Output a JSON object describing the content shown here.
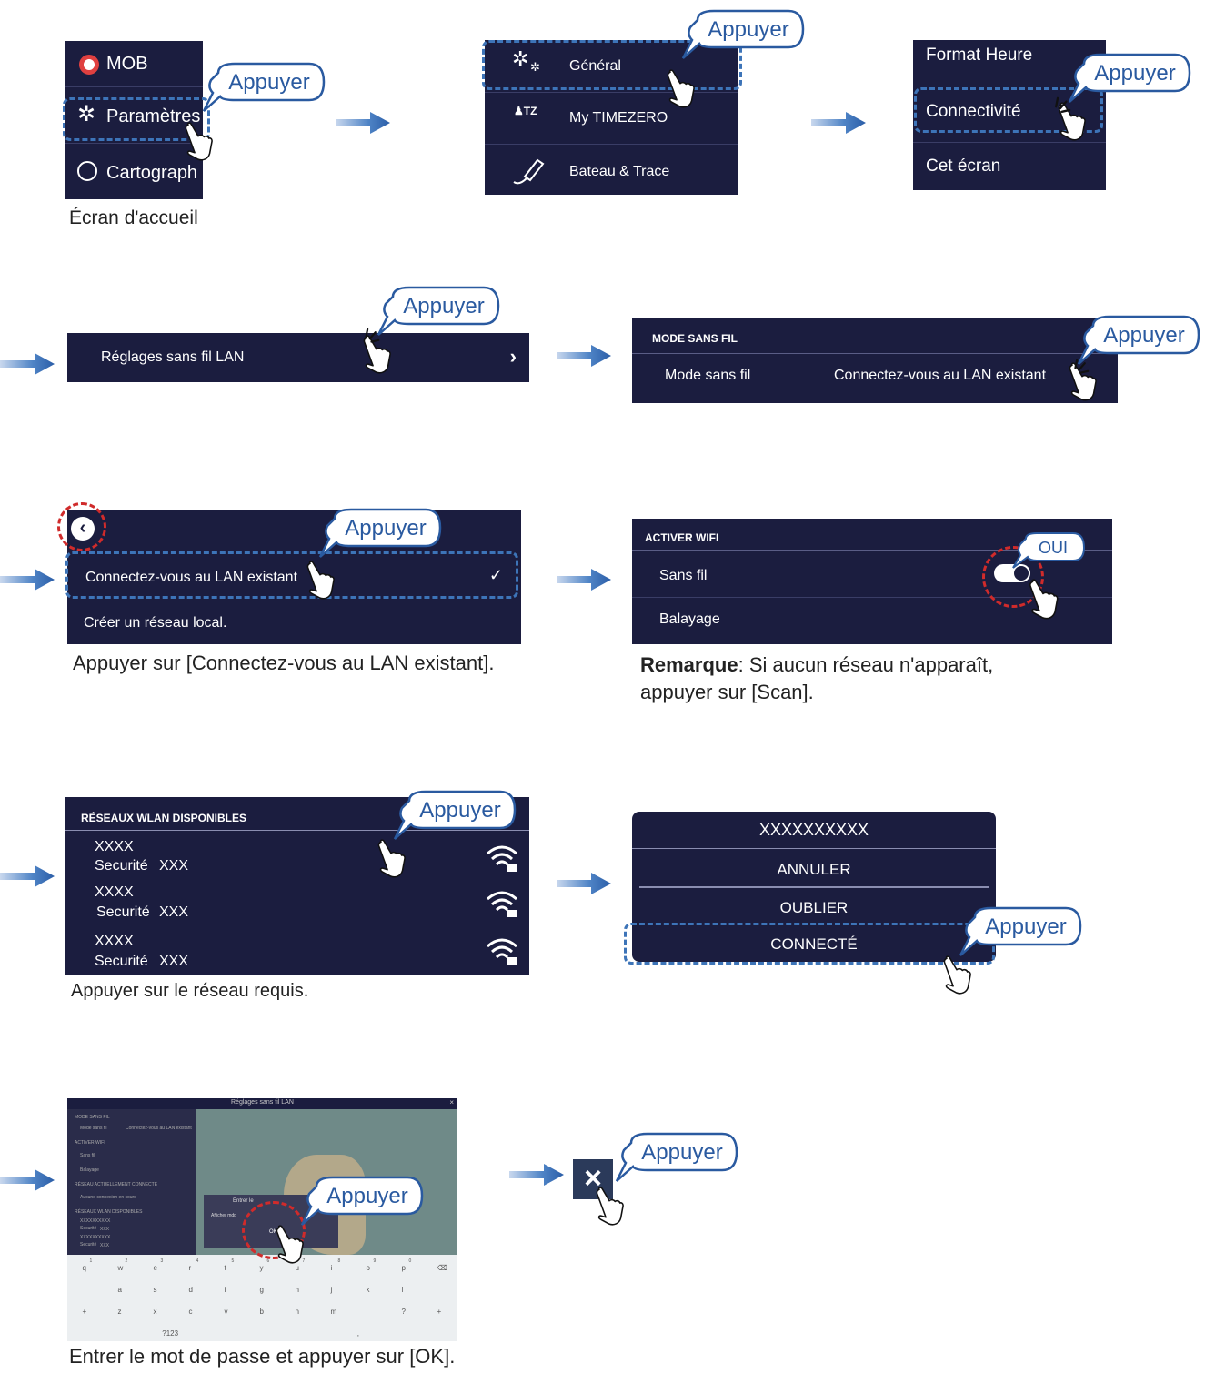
{
  "bubble_label": "Appuyer",
  "step1": {
    "items": [
      "MOB",
      "Paramètres",
      "Cartograph"
    ],
    "caption": "Écran d'accueil"
  },
  "step2": {
    "items": [
      "Général",
      "My TIMEZERO",
      "Bateau & Trace"
    ]
  },
  "step3": {
    "items": [
      "Format Heure",
      "Connectivité",
      "Cet écran"
    ]
  },
  "step4": {
    "item": "Réglages sans fil LAN"
  },
  "step5": {
    "header": "MODE SANS FIL",
    "label": "Mode sans fil",
    "value": "Connectez-vous au LAN existant"
  },
  "step6": {
    "items": [
      "Connectez-vous au LAN existant",
      "Créer un réseau local."
    ],
    "caption": "Appuyer sur [Connectez-vous au LAN existant]."
  },
  "step7": {
    "header": "ACTIVER WIFI",
    "items": [
      "Sans fil",
      "Balayage"
    ],
    "toggle_label": "OUI",
    "note_bold": "Remarque",
    "note_line1": ": Si aucun réseau n'apparaît,",
    "note_line2": "appuyer sur [Scan]."
  },
  "step8": {
    "header": "RÉSEAUX WLAN DISPONIBLES",
    "networks": [
      {
        "name": "XXXX",
        "security_label": "Securité",
        "security": "XXX"
      },
      {
        "name": "XXXX",
        "security_label": "Securité",
        "security": "XXX"
      },
      {
        "name": "XXXX",
        "security_label": "Securité",
        "security": "XXX"
      }
    ],
    "caption": "Appuyer sur le réseau requis."
  },
  "step9": {
    "title": "XXXXXXXXXX",
    "buttons": [
      "ANNULER",
      "OUBLIER",
      "CONNECTÉ"
    ]
  },
  "step10": {
    "screen_title": "Réglages sans fil LAN",
    "ok_label": "OK",
    "left_items": [
      "MODE SANS FIL",
      "Mode sans fil",
      "Connectez-vous au LAN existant",
      "ACTIVER WIFI",
      "Sans fil",
      "Balayage",
      "RÉSEAU ACTUELLEMENT CONNECTÉ",
      "Aucune connexion en cours",
      "RÉSEAUX WLAN DISPONIBLES",
      "XXXXXXXXXX",
      "Securité",
      "XXX",
      "XXXXXXXXXX",
      "Securité",
      "XXX"
    ],
    "dialog_label": "Entrer le",
    "dialog_option": "Afficher mdp",
    "kb_row1": [
      "q",
      "w",
      "e",
      "r",
      "t",
      "y",
      "u",
      "i",
      "o",
      "p",
      "⌫"
    ],
    "kb_row1_hints": [
      "1",
      "2",
      "3",
      "4",
      "5",
      "6",
      "7",
      "8",
      "9",
      "0"
    ],
    "kb_row2": [
      "a",
      "s",
      "d",
      "f",
      "g",
      "h",
      "j",
      "k",
      "l"
    ],
    "kb_row3": [
      "+",
      "z",
      "x",
      "c",
      "v",
      "b",
      "n",
      "m",
      "!",
      "?",
      "+"
    ],
    "kb_row4": [
      "?123",
      ","
    ],
    "caption": "Entrer le mot de passe et appuyer sur [OK]."
  },
  "step11": {
    "close_icon": "close-icon"
  },
  "colors": {
    "panel": "#1b1d3f",
    "accent": "#2a5aa0",
    "dash_blue": "#3d74b8",
    "dash_red": "#d02b2b",
    "arrow": "#3d74b8"
  }
}
